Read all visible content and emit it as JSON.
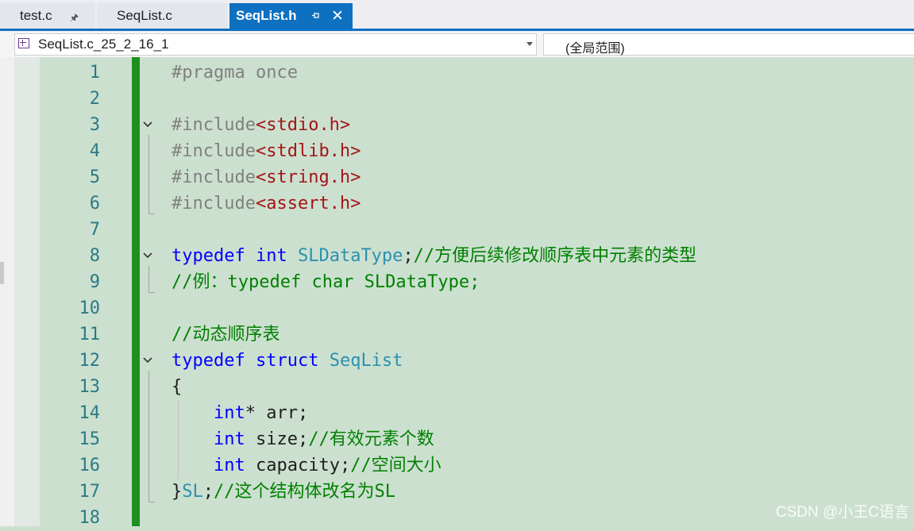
{
  "tabs": [
    {
      "label": "test.c",
      "active": false,
      "pinned": true
    },
    {
      "label": "SeqList.c",
      "active": false,
      "pinned": false
    },
    {
      "label": "SeqList.h",
      "active": true,
      "pinned": true
    }
  ],
  "nav": {
    "project_scope": "SeqList.c_25_2_16_1",
    "member_scope": "(全局范围)"
  },
  "colors": {
    "accent": "#0e70c0",
    "editor_bg": "#cce0d0",
    "change_bar": "#1f8f1f",
    "keyword": "#0000ff",
    "type": "#2b91af",
    "string": "#a31515",
    "comment": "#008000",
    "preprocessor": "#808080"
  },
  "code": {
    "lines": [
      {
        "num": "1",
        "tokens": [
          [
            "pp",
            "#pragma once"
          ]
        ]
      },
      {
        "num": "2",
        "tokens": []
      },
      {
        "num": "3",
        "tokens": [
          [
            "pp",
            "#include"
          ],
          [
            "str",
            "<stdio.h>"
          ]
        ]
      },
      {
        "num": "4",
        "tokens": [
          [
            "pp",
            "#include"
          ],
          [
            "str",
            "<stdlib.h>"
          ]
        ]
      },
      {
        "num": "5",
        "tokens": [
          [
            "pp",
            "#include"
          ],
          [
            "str",
            "<string.h>"
          ]
        ]
      },
      {
        "num": "6",
        "tokens": [
          [
            "pp",
            "#include"
          ],
          [
            "str",
            "<assert.h>"
          ]
        ]
      },
      {
        "num": "7",
        "tokens": []
      },
      {
        "num": "8",
        "tokens": [
          [
            "kw",
            "typedef"
          ],
          [
            "pl",
            " "
          ],
          [
            "kw",
            "int"
          ],
          [
            "pl",
            " "
          ],
          [
            "typ",
            "SLDataType"
          ],
          [
            "pl",
            ";"
          ],
          [
            "cm",
            "//方便后续修改顺序表中元素的类型"
          ]
        ]
      },
      {
        "num": "9",
        "tokens": [
          [
            "cm",
            "//例：typedef char SLDataType;"
          ]
        ]
      },
      {
        "num": "10",
        "tokens": []
      },
      {
        "num": "11",
        "tokens": [
          [
            "cm",
            "//动态顺序表"
          ]
        ]
      },
      {
        "num": "12",
        "tokens": [
          [
            "kw",
            "typedef"
          ],
          [
            "pl",
            " "
          ],
          [
            "kw",
            "struct"
          ],
          [
            "pl",
            " "
          ],
          [
            "typ",
            "SeqList"
          ]
        ]
      },
      {
        "num": "13",
        "tokens": [
          [
            "pl",
            "{"
          ]
        ]
      },
      {
        "num": "14",
        "tokens": [
          [
            "pl",
            "    "
          ],
          [
            "kw",
            "int"
          ],
          [
            "pl",
            "* arr;"
          ]
        ]
      },
      {
        "num": "15",
        "tokens": [
          [
            "pl",
            "    "
          ],
          [
            "kw",
            "int"
          ],
          [
            "pl",
            " size;"
          ],
          [
            "cm",
            "//有效元素个数"
          ]
        ]
      },
      {
        "num": "16",
        "tokens": [
          [
            "pl",
            "    "
          ],
          [
            "kw",
            "int"
          ],
          [
            "pl",
            " capacity;"
          ],
          [
            "cm",
            "//空间大小"
          ]
        ]
      },
      {
        "num": "17",
        "tokens": [
          [
            "pl",
            "}"
          ],
          [
            "typ",
            "SL"
          ],
          [
            "pl",
            ";"
          ],
          [
            "cm",
            "//这个结构体改名为SL"
          ]
        ]
      },
      {
        "num": "18",
        "tokens": []
      }
    ]
  },
  "watermark": "CSDN @小王C语言"
}
